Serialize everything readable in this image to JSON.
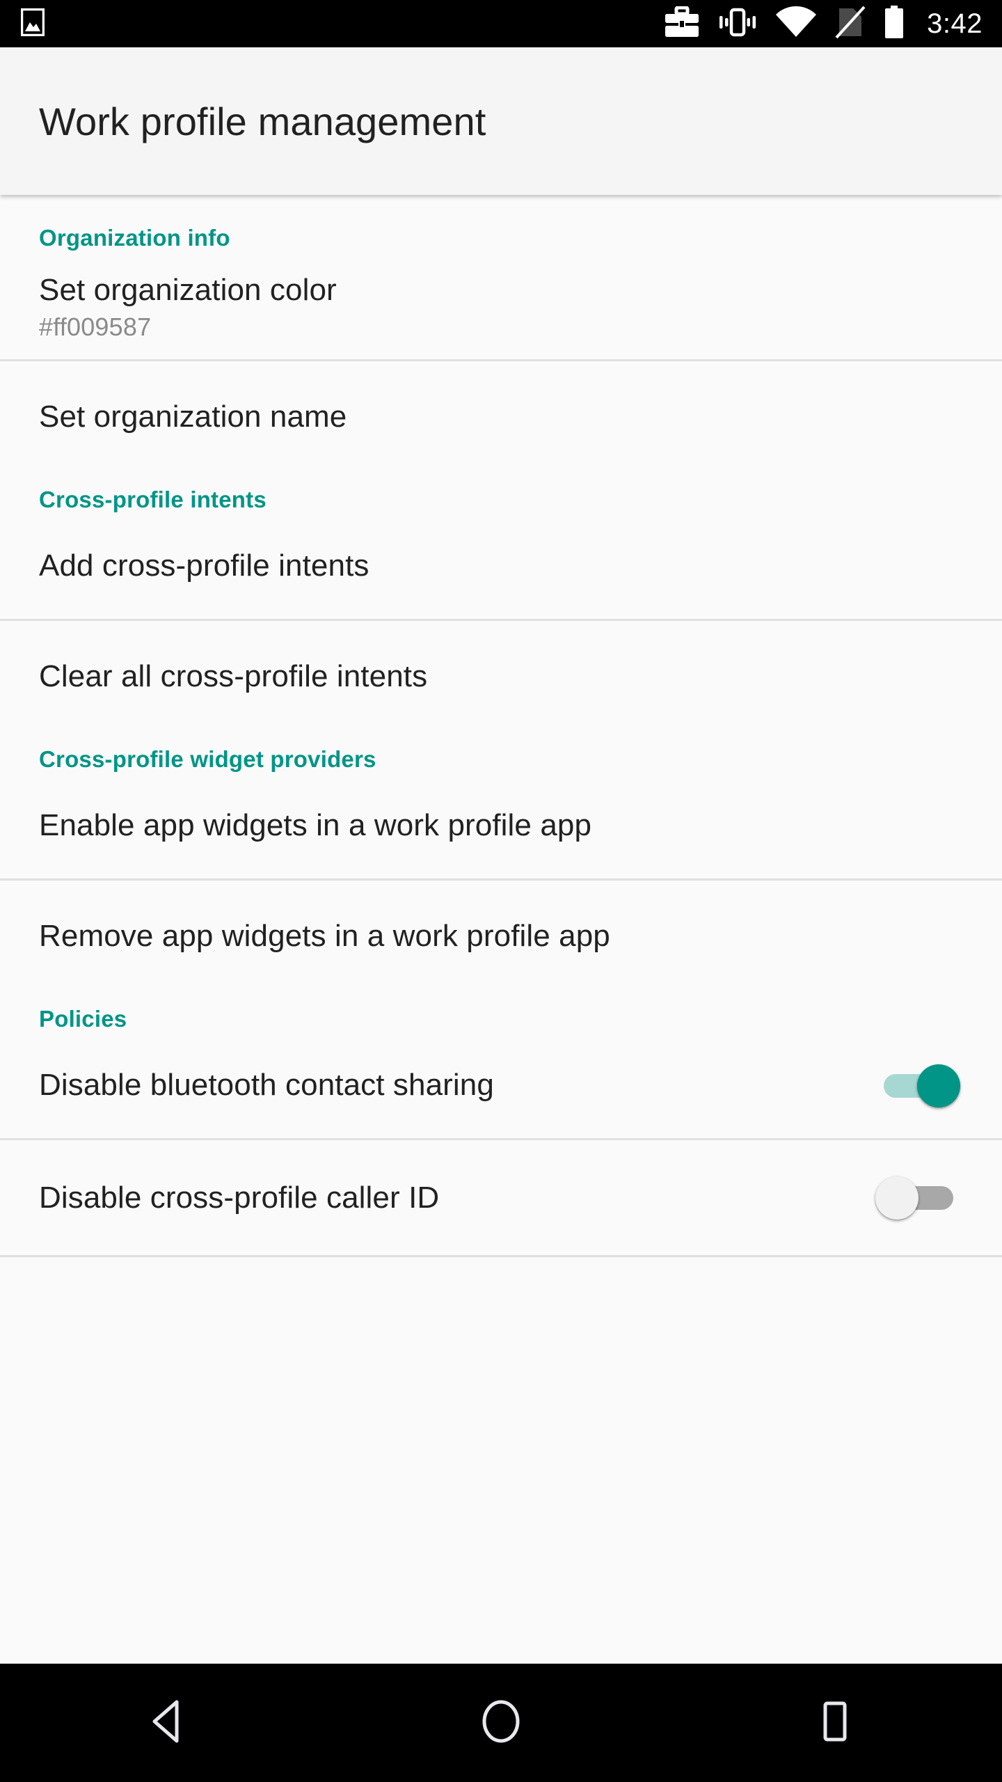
{
  "statusbar": {
    "left_icons": [
      {
        "name": "image-icon"
      }
    ],
    "right_icons": [
      {
        "name": "work-profile-briefcase-icon"
      },
      {
        "name": "vibrate-icon"
      },
      {
        "name": "wifi-icon"
      },
      {
        "name": "no-sim-icon"
      },
      {
        "name": "battery-full-icon"
      }
    ],
    "clock": "3:42"
  },
  "toolbar": {
    "title": "Work profile management"
  },
  "colors": {
    "accent_teal": "#009587",
    "track_on": "#a7d7d2",
    "track_off": "#a8a8a8",
    "thumb_off": "#f1f1f1",
    "divider": "#e0e0e0",
    "background": "#fafafa",
    "toolbar_bg": "#f5f5f6",
    "primary_text": "#212121",
    "secondary_text": "#8a8a8a"
  },
  "sections": [
    {
      "header": "Organization info",
      "rows": [
        {
          "title": "Set organization color",
          "subtitle": "#ff009587",
          "has_switch": false
        },
        {
          "title": "Set organization name",
          "subtitle": null,
          "has_switch": false
        }
      ]
    },
    {
      "header": "Cross-profile intents",
      "rows": [
        {
          "title": "Add cross-profile intents",
          "subtitle": null,
          "has_switch": false
        },
        {
          "title": "Clear all cross-profile intents",
          "subtitle": null,
          "has_switch": false
        }
      ]
    },
    {
      "header": "Cross-profile widget providers",
      "rows": [
        {
          "title": "Enable app widgets in a work profile app",
          "subtitle": null,
          "has_switch": false
        },
        {
          "title": "Remove app widgets in a work profile app",
          "subtitle": null,
          "has_switch": false
        }
      ]
    },
    {
      "header": "Policies",
      "rows": [
        {
          "title": "Disable bluetooth contact sharing",
          "subtitle": null,
          "has_switch": true,
          "switch_on": true
        },
        {
          "title": "Disable cross-profile caller ID",
          "subtitle": null,
          "has_switch": true,
          "switch_on": false
        }
      ]
    }
  ],
  "navbar": {
    "buttons": [
      {
        "name": "back-button",
        "icon": "back-triangle-icon"
      },
      {
        "name": "home-button",
        "icon": "home-circle-icon"
      },
      {
        "name": "recents-button",
        "icon": "recents-square-icon"
      }
    ]
  }
}
